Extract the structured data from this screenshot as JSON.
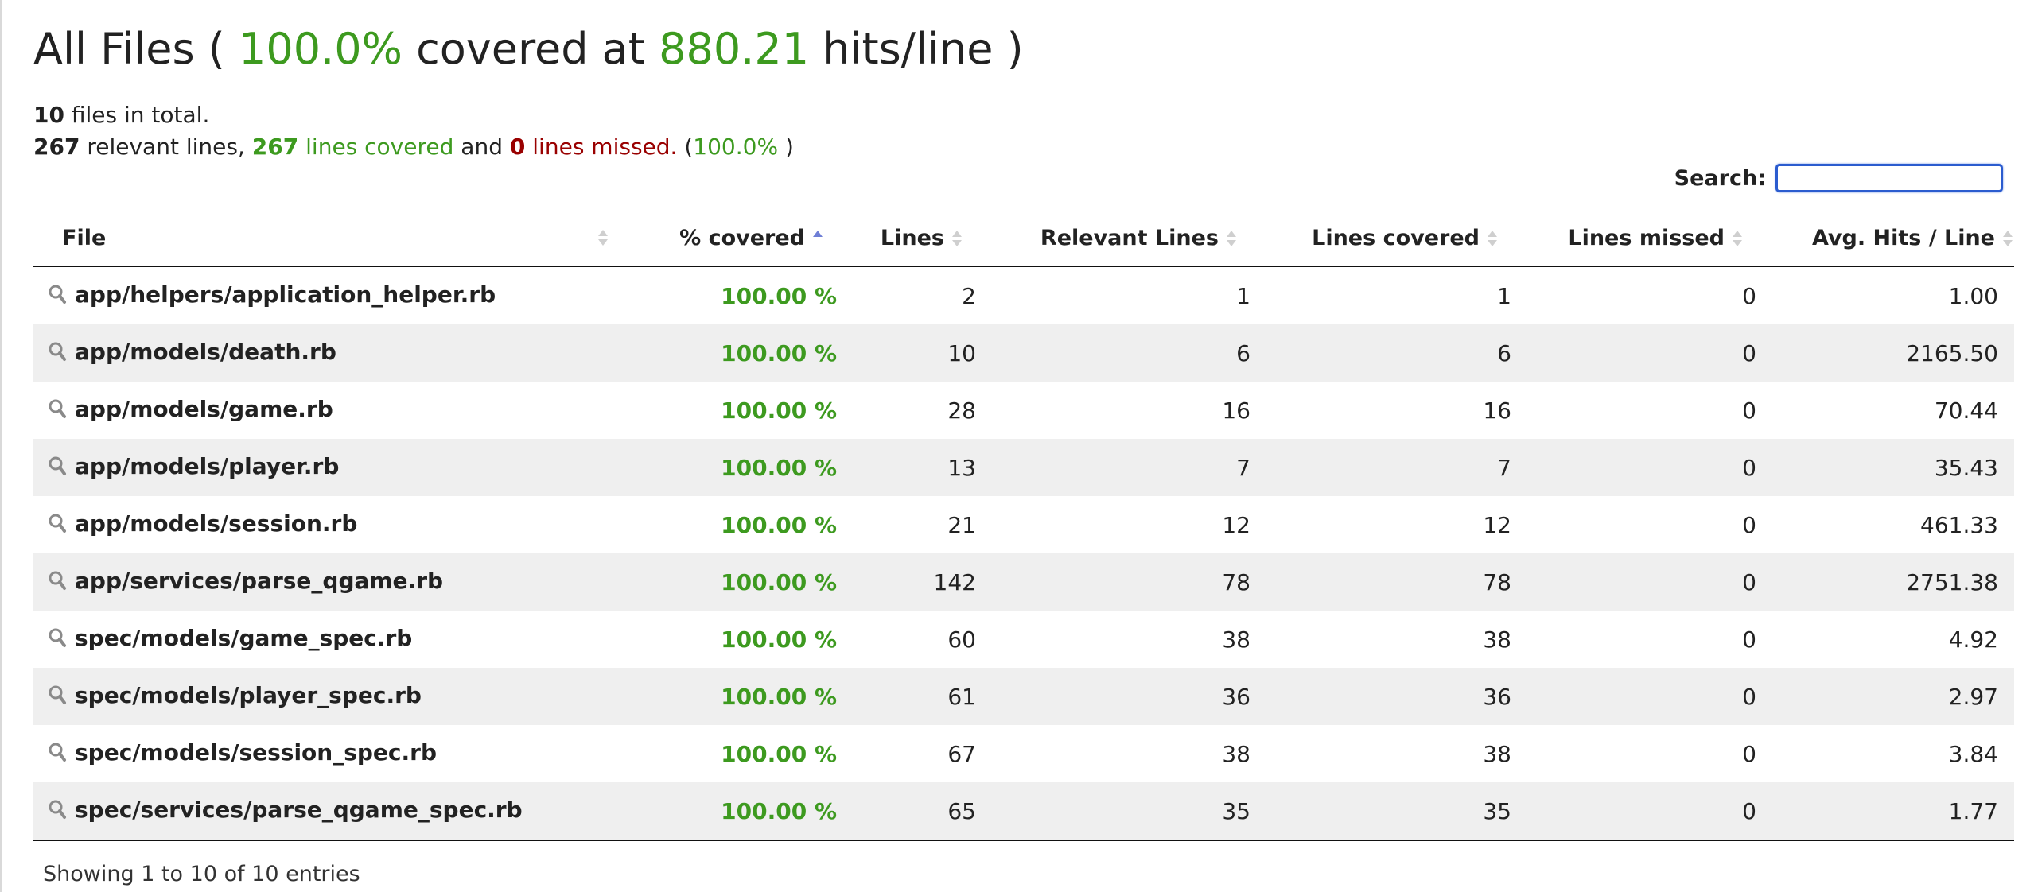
{
  "heading": {
    "prefix": "All Files (",
    "percent": "100.0%",
    "middle": "covered at",
    "hits": "880.21",
    "suffix": "hits/line )"
  },
  "summary": {
    "files_count": "10",
    "files_text": "files in total.",
    "relevant_count": "267",
    "relevant_text": "relevant lines,",
    "covered_count": "267",
    "covered_text": "lines covered",
    "and_text": "and",
    "missed_count": "0",
    "missed_text": "lines missed.",
    "paren_open": "(",
    "percent": "100.0%",
    "paren_close": ")"
  },
  "search": {
    "label": "Search:",
    "value": ""
  },
  "table": {
    "headers": {
      "file": "File",
      "covered": "% covered",
      "lines": "Lines",
      "relevant": "Relevant Lines",
      "lines_covered": "Lines covered",
      "lines_missed": "Lines missed",
      "avg_hits": "Avg. Hits / Line"
    },
    "sorted_by": "covered",
    "sort_direction": "ascending",
    "rows": [
      {
        "file": "app/helpers/application_helper.rb",
        "covered": "100.00 %",
        "lines": "2",
        "relevant": "1",
        "lines_covered": "1",
        "lines_missed": "0",
        "avg_hits": "1.00"
      },
      {
        "file": "app/models/death.rb",
        "covered": "100.00 %",
        "lines": "10",
        "relevant": "6",
        "lines_covered": "6",
        "lines_missed": "0",
        "avg_hits": "2165.50"
      },
      {
        "file": "app/models/game.rb",
        "covered": "100.00 %",
        "lines": "28",
        "relevant": "16",
        "lines_covered": "16",
        "lines_missed": "0",
        "avg_hits": "70.44"
      },
      {
        "file": "app/models/player.rb",
        "covered": "100.00 %",
        "lines": "13",
        "relevant": "7",
        "lines_covered": "7",
        "lines_missed": "0",
        "avg_hits": "35.43"
      },
      {
        "file": "app/models/session.rb",
        "covered": "100.00 %",
        "lines": "21",
        "relevant": "12",
        "lines_covered": "12",
        "lines_missed": "0",
        "avg_hits": "461.33"
      },
      {
        "file": "app/services/parse_qgame.rb",
        "covered": "100.00 %",
        "lines": "142",
        "relevant": "78",
        "lines_covered": "78",
        "lines_missed": "0",
        "avg_hits": "2751.38"
      },
      {
        "file": "spec/models/game_spec.rb",
        "covered": "100.00 %",
        "lines": "60",
        "relevant": "38",
        "lines_covered": "38",
        "lines_missed": "0",
        "avg_hits": "4.92"
      },
      {
        "file": "spec/models/player_spec.rb",
        "covered": "100.00 %",
        "lines": "61",
        "relevant": "36",
        "lines_covered": "36",
        "lines_missed": "0",
        "avg_hits": "2.97"
      },
      {
        "file": "spec/models/session_spec.rb",
        "covered": "100.00 %",
        "lines": "67",
        "relevant": "38",
        "lines_covered": "38",
        "lines_missed": "0",
        "avg_hits": "3.84"
      },
      {
        "file": "spec/services/parse_qgame_spec.rb",
        "covered": "100.00 %",
        "lines": "65",
        "relevant": "35",
        "lines_covered": "35",
        "lines_missed": "0",
        "avg_hits": "1.77"
      }
    ]
  },
  "footer": {
    "info": "Showing 1 to 10 of 10 entries"
  },
  "colors": {
    "green": "#3d9a1f",
    "red": "#990000",
    "row_alt": "#efefef",
    "search_border": "#2b5ccf"
  },
  "icons": {
    "row_icon": "magnifier-icon",
    "sort_icon": "sort-both-icon",
    "sort_active_icon": "sort-asc-icon"
  }
}
